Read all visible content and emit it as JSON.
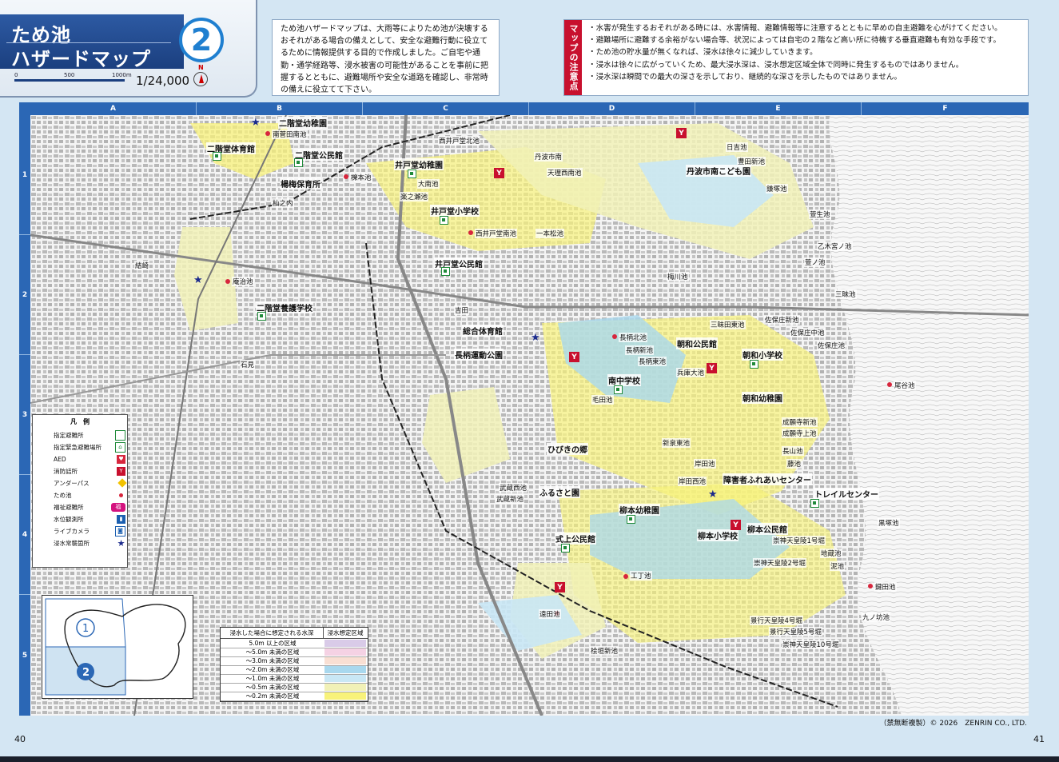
{
  "title": {
    "line1": "ため池",
    "line2": "ハザードマップ",
    "area_number": "2",
    "scale_ratio": "1/24,000",
    "scale_ticks": [
      "0",
      "500",
      "1000m"
    ],
    "north": "N"
  },
  "intro_text": "ため池ハザードマップは、大雨等によりため池が決壊するおそれがある場合の備えとして、安全な避難行動に役立てるために情報提供する目的で作成しました。ご自宅や通勤・通学経路等、浸水被害の可能性があることを事前に把握するとともに、避難場所や安全な道路を確認し、非常時の備えに役立てて下さい。",
  "notes": {
    "label": "マップの注意点",
    "items": [
      "・水害が発生するおそれがある時には、水害情報、避難情報等に注意するとともに早めの自主避難を心がけてください。",
      "・避難場所に避難する余裕がない場合等、状況によっては自宅の２階など高い所に待機する垂直避難も有効な手段です。",
      "・ため池の貯水量が無くなれば、浸水は徐々に減少していきます。",
      "・浸水は徐々に広がっていくため、最大浸水深は、浸水想定区域全体で同時に発生するものではありません。",
      "・浸水深は瞬間での最大の深さを示しており、継続的な深さを示したものではありません。"
    ]
  },
  "grid": {
    "columns": [
      "A",
      "B",
      "C",
      "D",
      "E",
      "F"
    ],
    "rows": [
      "1",
      "2",
      "3",
      "4",
      "5"
    ]
  },
  "legend": {
    "title": "凡　例",
    "items": [
      {
        "label": "指定避難所",
        "icon": "shelter-icon",
        "color": "#1f8a3a"
      },
      {
        "label": "指定緊急避難場所",
        "icon": "emergency-site-icon",
        "color": "#1f8a3a"
      },
      {
        "label": "AED",
        "icon": "aed-icon",
        "color": "#d7263d"
      },
      {
        "label": "消防詰所",
        "icon": "fire-station-icon",
        "color": "#c8102e"
      },
      {
        "label": "アンダーパス",
        "icon": "underpass-icon",
        "color": "#f2c200"
      },
      {
        "label": "ため池",
        "icon": "pond-dot-icon",
        "color": "#d7263d"
      },
      {
        "label": "福祉避難所",
        "icon": "welfare-icon",
        "color": "#d4137f"
      },
      {
        "label": "水位観測所",
        "icon": "water-gauge-icon",
        "color": "#1b5fb0"
      },
      {
        "label": "ライブカメラ",
        "icon": "camera-icon",
        "color": "#1b5fb0"
      },
      {
        "label": "浸水常襲箇所",
        "icon": "star-icon",
        "color": "#1b2a8c"
      }
    ]
  },
  "depth_legend": {
    "header_left": "浸水した場合に想定される水深",
    "header_right": "浸水想定区域",
    "rows": [
      {
        "label": "5.0m 以上の区域",
        "color": "#d9cbe8"
      },
      {
        "label": "～5.0m 未満の区域",
        "color": "#f5d2e4"
      },
      {
        "label": "～3.0m 未満の区域",
        "color": "#f9dfd3"
      },
      {
        "label": "～2.0m 未満の区域",
        "color": "#a9d8ee"
      },
      {
        "label": "～1.0m 未満の区域",
        "color": "#c9e7f5"
      },
      {
        "label": "～0.5m 未満の区域",
        "color": "#f1f1b7"
      },
      {
        "label": "～0.2m 未満の区域",
        "color": "#f8f27a"
      }
    ]
  },
  "inset": {
    "area1": "1",
    "area2": "2"
  },
  "places": [
    "二階堂幼稚園",
    "南菅田南池",
    "二階堂体育館",
    "二階堂公民館",
    "櫟本池",
    "楊梅保育所",
    "杣之内",
    "井戸堂幼稚園",
    "大南池",
    "楽之瀬池",
    "井戸堂小学校",
    "西井戸堂南池",
    "一本松池",
    "井戸堂公民館",
    "結崎",
    "庵治池",
    "二階堂養護学校",
    "吉田",
    "石見",
    "総合体育館",
    "長柄運動公園",
    "長柄北池",
    "長柄新池",
    "長柄東池",
    "南中学校",
    "毛田池",
    "朝和公民館",
    "朝和小学校",
    "朝和幼稚園",
    "兵庫大池",
    "三昧田東池",
    "佐保庄新池",
    "佐保庄中池",
    "佐保庄池",
    "ひびきの郷",
    "新泉東池",
    "岸田池",
    "岸田西池",
    "障害者ふれあいセンター",
    "トレイルセンター",
    "ふるさと園",
    "武蔵西池",
    "武蔵新池",
    "柳本幼稚園",
    "柳本小学校",
    "柳本公民館",
    "式上公民館",
    "崇神天皇陵1号堀",
    "崇神天皇陵2号堀",
    "崇神天皇陵10号堀",
    "景行天皇陵4号堀",
    "景行天皇陵5号堀",
    "工丁池",
    "遠田池",
    "桧垣新池",
    "鍵田池",
    "九ノ坊池",
    "地蔵池",
    "泥池",
    "黒塚池",
    "尾谷池",
    "乙木宮ノ池",
    "萱ノ池",
    "三昧池",
    "梅川池",
    "西井戸堂北池",
    "丹波市南こども園",
    "丹波市南",
    "鎌塚池",
    "天理西南池",
    "日吉池",
    "豊田新池",
    "成願寺新池",
    "成願寺上池",
    "長山池",
    "藤池",
    "萱生池"
  ],
  "copyright": "（禁無断複製）© 2026　ZENRIN CO., LTD.",
  "page_left": "40",
  "page_right": "41",
  "colors": {
    "frame": "#2b67b5",
    "title_band": "#1b3f7f",
    "pond": "#d7263d",
    "flood_yellow": "#f8f27a",
    "flood_blue": "#a9d8ee"
  }
}
